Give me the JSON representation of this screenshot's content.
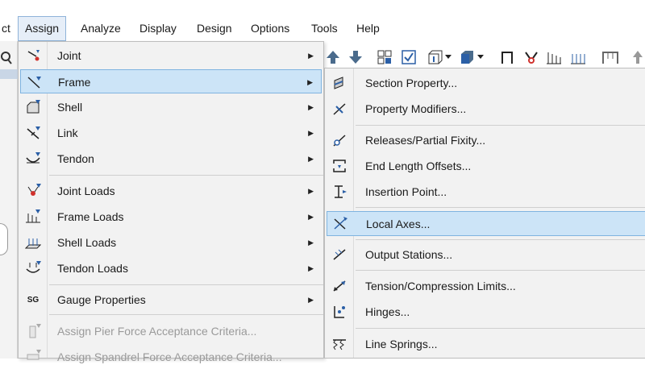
{
  "menubar": {
    "items": [
      "ct",
      "Assign",
      "Analyze",
      "Display",
      "Design",
      "Options",
      "Tools",
      "Help"
    ]
  },
  "assign_menu": {
    "items": [
      {
        "label": "Joint",
        "icon": "joint-icon",
        "submenu": true
      },
      {
        "label": "Frame",
        "icon": "frame-icon",
        "submenu": true,
        "highlighted": true
      },
      {
        "label": "Shell",
        "icon": "shell-icon",
        "submenu": true
      },
      {
        "label": "Link",
        "icon": "link-icon",
        "submenu": true
      },
      {
        "label": "Tendon",
        "icon": "tendon-icon",
        "submenu": true
      },
      {
        "label": "Joint Loads",
        "icon": "joint-loads-icon",
        "submenu": true
      },
      {
        "label": "Frame Loads",
        "icon": "frame-loads-icon",
        "submenu": true
      },
      {
        "label": "Shell Loads",
        "icon": "shell-loads-icon",
        "submenu": true
      },
      {
        "label": "Tendon Loads",
        "icon": "tendon-loads-icon",
        "submenu": true
      },
      {
        "label": "Gauge Properties",
        "icon": "gauge-icon",
        "submenu": true
      },
      {
        "label": "Assign Pier Force Acceptance Criteria...",
        "icon": "pier-criteria-icon",
        "disabled": true
      },
      {
        "label": "Assign Spandrel Force Acceptance Criteria...",
        "icon": "spandrel-criteria-icon",
        "disabled": true
      }
    ],
    "gauge_icon_text": "SG"
  },
  "frame_submenu": {
    "items": [
      {
        "label": "Section Property...",
        "icon": "section-property-icon"
      },
      {
        "label": "Property Modifiers...",
        "icon": "property-modifiers-icon"
      },
      {
        "label": "Releases/Partial Fixity...",
        "icon": "releases-icon"
      },
      {
        "label": "End Length Offsets...",
        "icon": "end-length-offsets-icon"
      },
      {
        "label": "Insertion Point...",
        "icon": "insertion-point-icon"
      },
      {
        "label": "Local Axes...",
        "icon": "local-axes-icon",
        "highlighted": true
      },
      {
        "label": "Output Stations...",
        "icon": "output-stations-icon"
      },
      {
        "label": "Tension/Compression Limits...",
        "icon": "tension-compression-icon"
      },
      {
        "label": "Hinges...",
        "icon": "hinges-icon"
      },
      {
        "label": "Line Springs...",
        "icon": "line-springs-icon"
      }
    ]
  },
  "colors": {
    "highlight_bg": "#cce4f7",
    "highlight_border": "#7fb4e0",
    "menu_bg": "#f2f2f2",
    "icon_blue": "#2b5fa6",
    "icon_red": "#d0312d"
  }
}
